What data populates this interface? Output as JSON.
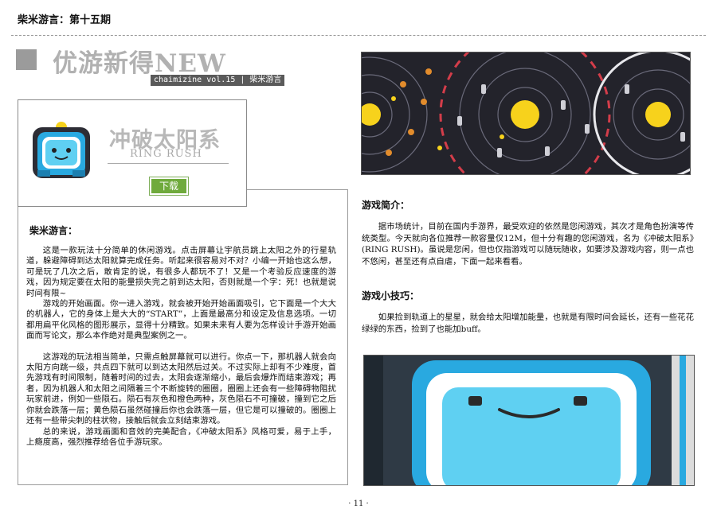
{
  "header": {
    "title": "柴米游言：第十五期"
  },
  "section": {
    "title": "优游新得NEW",
    "tag": "chaimizine vol.15 | 柴米游言"
  },
  "app": {
    "name": "冲破太阳系",
    "subtitle": "RING RUSH",
    "download_label": "下载"
  },
  "review": {
    "heading": "柴米游言：",
    "paragraphs": [
      "这是一款玩法十分简单的休闲游戏。点击屏幕让宇航员跳上太阳之外的行星轨道，躲避障碍到达太阳就算完成任务。听起来很容易对不对？小编一开始也这么想，可是玩了几次之后，敢肯定的说，有很多人都玩不了！又是一个考验反应速度的游戏，因为规定要在太阳的能量损失完之前到达太阳，否则就是一个字：死！也就是说时间有限~",
      "游戏的开始画面。你一进入游戏，就会被开始开始画面吸引，它下面是一个大大的机器人，它的身体上是大大的“START”，上面是最高分和设定及信息选项。一切都用扁平化风格的图形展示，显得十分精致。如果未来有人要为怎样设计手游开始画面而写论文，那么本作绝对是典型案例之一。",
      "这游戏的玩法相当简单，只需点触屏幕就可以进行。你点一下，那机器人就会向太阳方向跳一级，共点四下就可以到达太阳然后过关。不过实际上却有不少难度，首先游戏有时间限制，随着时间的过去，太阳会逐渐缩小，最后会爆炸而结束游戏；再者，因为机器人和太阳之间隔着三个不断旋转的圈圈，圈圈上还会有一些障碍物阻扰玩家前进，例如一些陨石。陨石有灰色和橙色两种，灰色陨石不可撞破，撞到它之后你就会跌落一层；黄色陨石虽然碰撞后你也会跌落一层，但它是可以撞破的。圈圈上还有一些带尖刺的柱状物，接触后就会立刻结束游戏。",
      "总的来说，游戏画面和音效的完美配合，《冲破太阳系》风格可爱，易于上手，上瘾度高，强烈推荐给各位手游玩家。"
    ]
  },
  "intro": {
    "heading": "游戏简介：",
    "text": "据市场统计，目前在国内手游界，最受欢迎的依然是您闲游戏，其次才是角色扮演等传统类型。今天就向各位推荐一款容量仅12M，但十分有趣的您闲游戏，名为《冲破太阳系》(RING RUSH)。虽说是您闲，但也仅指游戏可以随玩随收，如要涉及游戏内容，则一点也不悠闲，甚至还有点自虐，下面一起来看看。"
  },
  "tips": {
    "heading": "游戏小技巧：",
    "text": "如果捡到轨道上的星星，就会给太阳增加能量，也就是有限时间会延长，还有一些花花绿绿的东西，捡到了也能加buff。"
  },
  "footer": {
    "page_number": "· 11 ·"
  },
  "colors": {
    "accent_green": "#6faa3c",
    "gray_title": "#b1b1b1",
    "banner_bg": "#23232b",
    "sun": "#f7d21c",
    "robot_blue": "#29a9e0"
  }
}
